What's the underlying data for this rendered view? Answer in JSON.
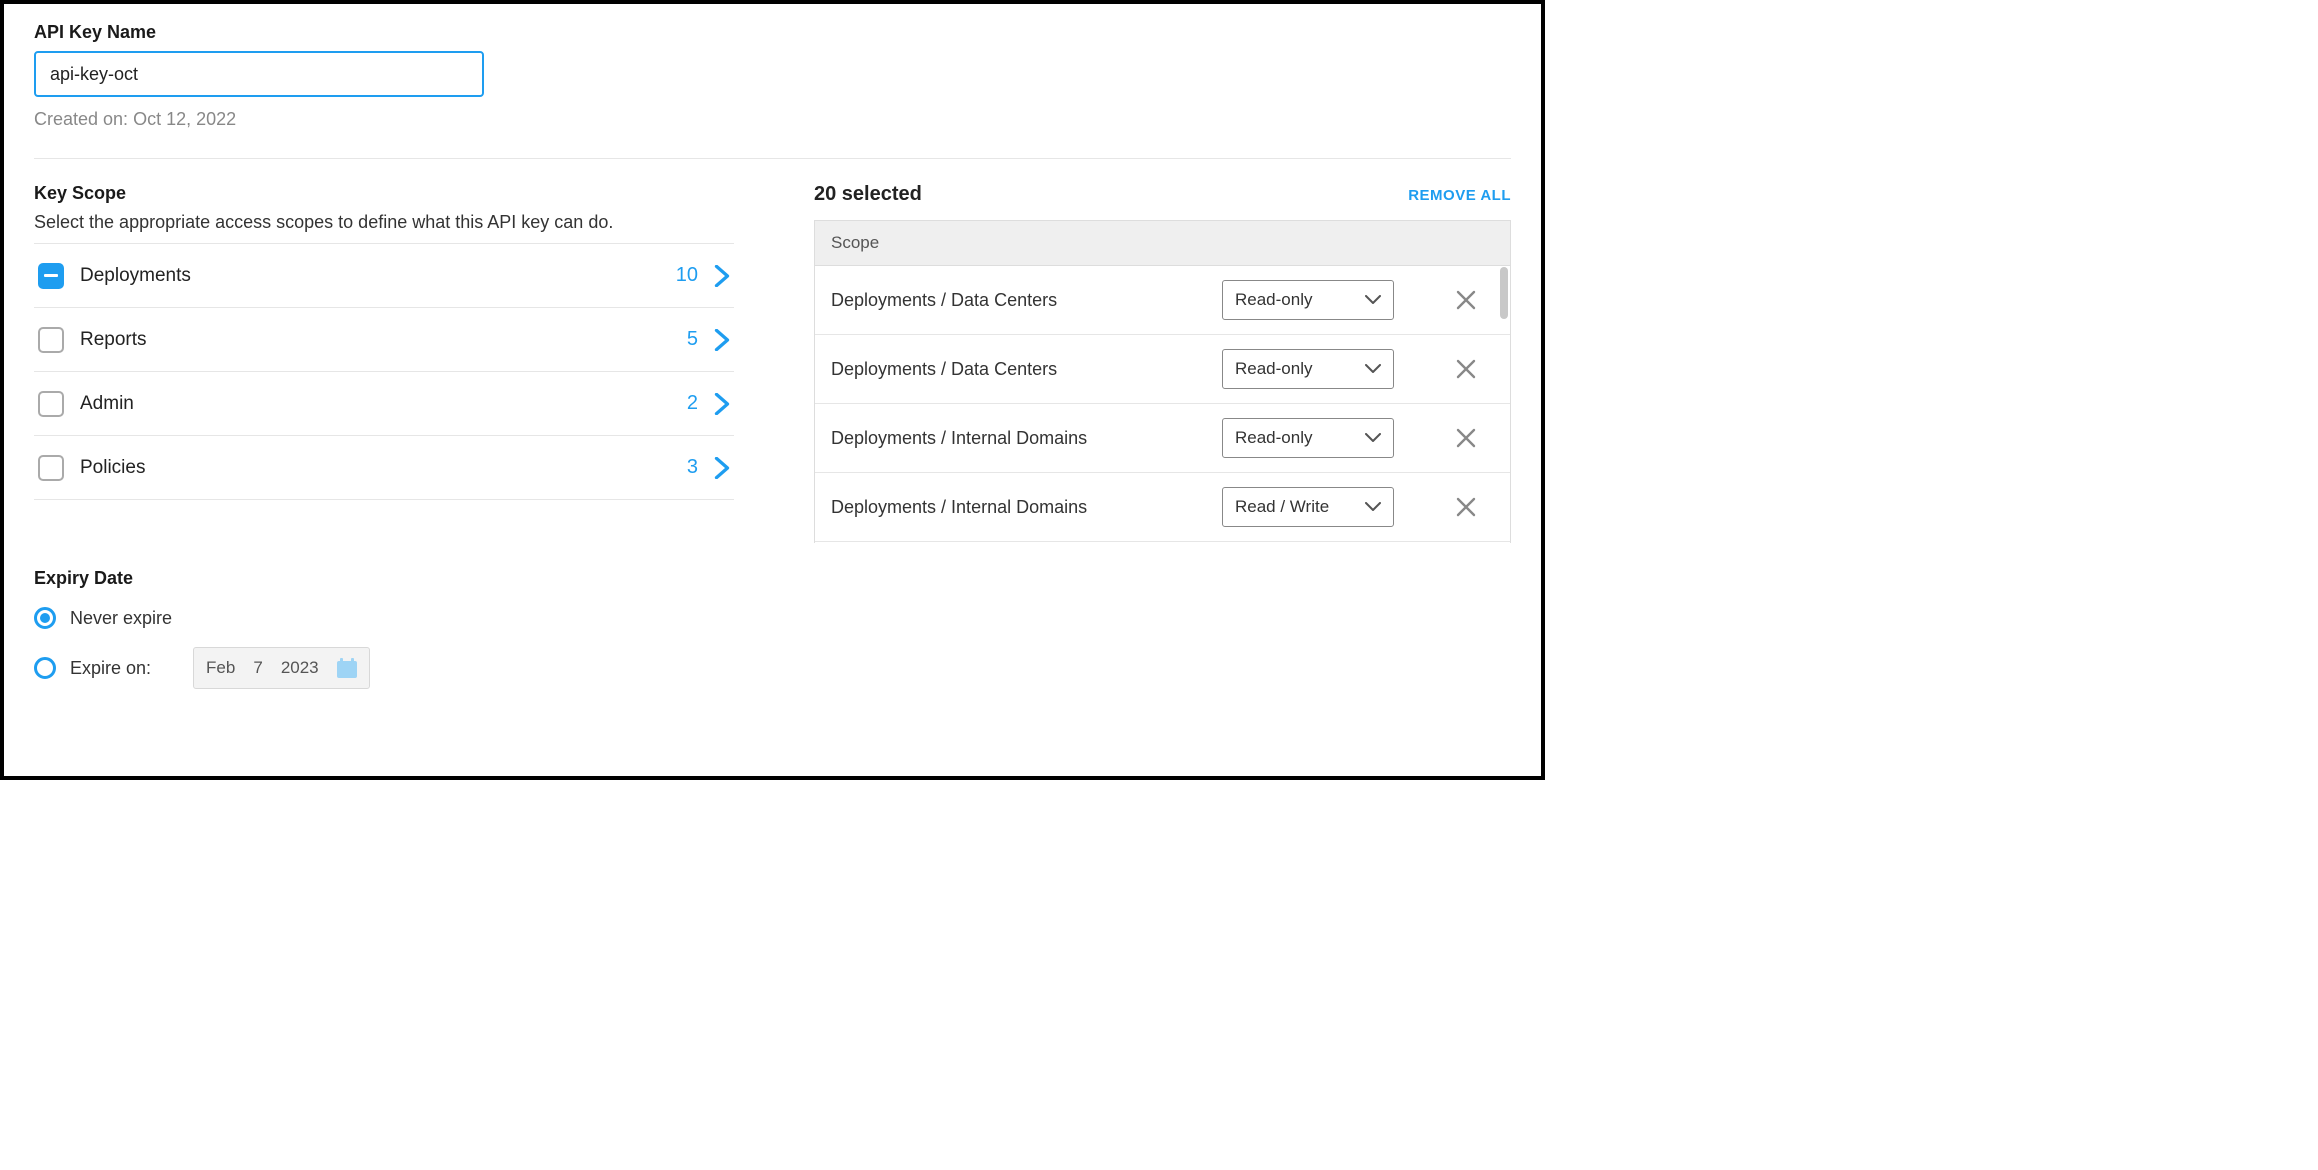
{
  "apiKeyName": {
    "label": "API Key Name",
    "value": "api-key-oct",
    "createdPrefix": "Created on: ",
    "createdDate": "Oct 12, 2022"
  },
  "keyScope": {
    "label": "Key Scope",
    "description": "Select the appropriate access scopes to define what this API key can do.",
    "items": [
      {
        "name": "Deployments",
        "count": "10",
        "state": "partial"
      },
      {
        "name": "Reports",
        "count": "5",
        "state": "empty"
      },
      {
        "name": "Admin",
        "count": "2",
        "state": "empty"
      },
      {
        "name": "Policies",
        "count": "3",
        "state": "empty"
      }
    ]
  },
  "selected": {
    "countLabel": "20 selected",
    "removeAllLabel": "REMOVE ALL",
    "headerLabel": "Scope",
    "rows": [
      {
        "label": "Deployments / Data Centers",
        "permission": "Read-only"
      },
      {
        "label": "Deployments / Data Centers",
        "permission": "Read-only"
      },
      {
        "label": "Deployments / Internal Domains",
        "permission": "Read-only"
      },
      {
        "label": "Deployments / Internal Domains",
        "permission": "Read / Write"
      }
    ]
  },
  "expiry": {
    "label": "Expiry Date",
    "neverLabel": "Never expire",
    "expireOnLabel": "Expire on:",
    "date": {
      "month": "Feb",
      "day": "7",
      "year": "2023"
    }
  }
}
